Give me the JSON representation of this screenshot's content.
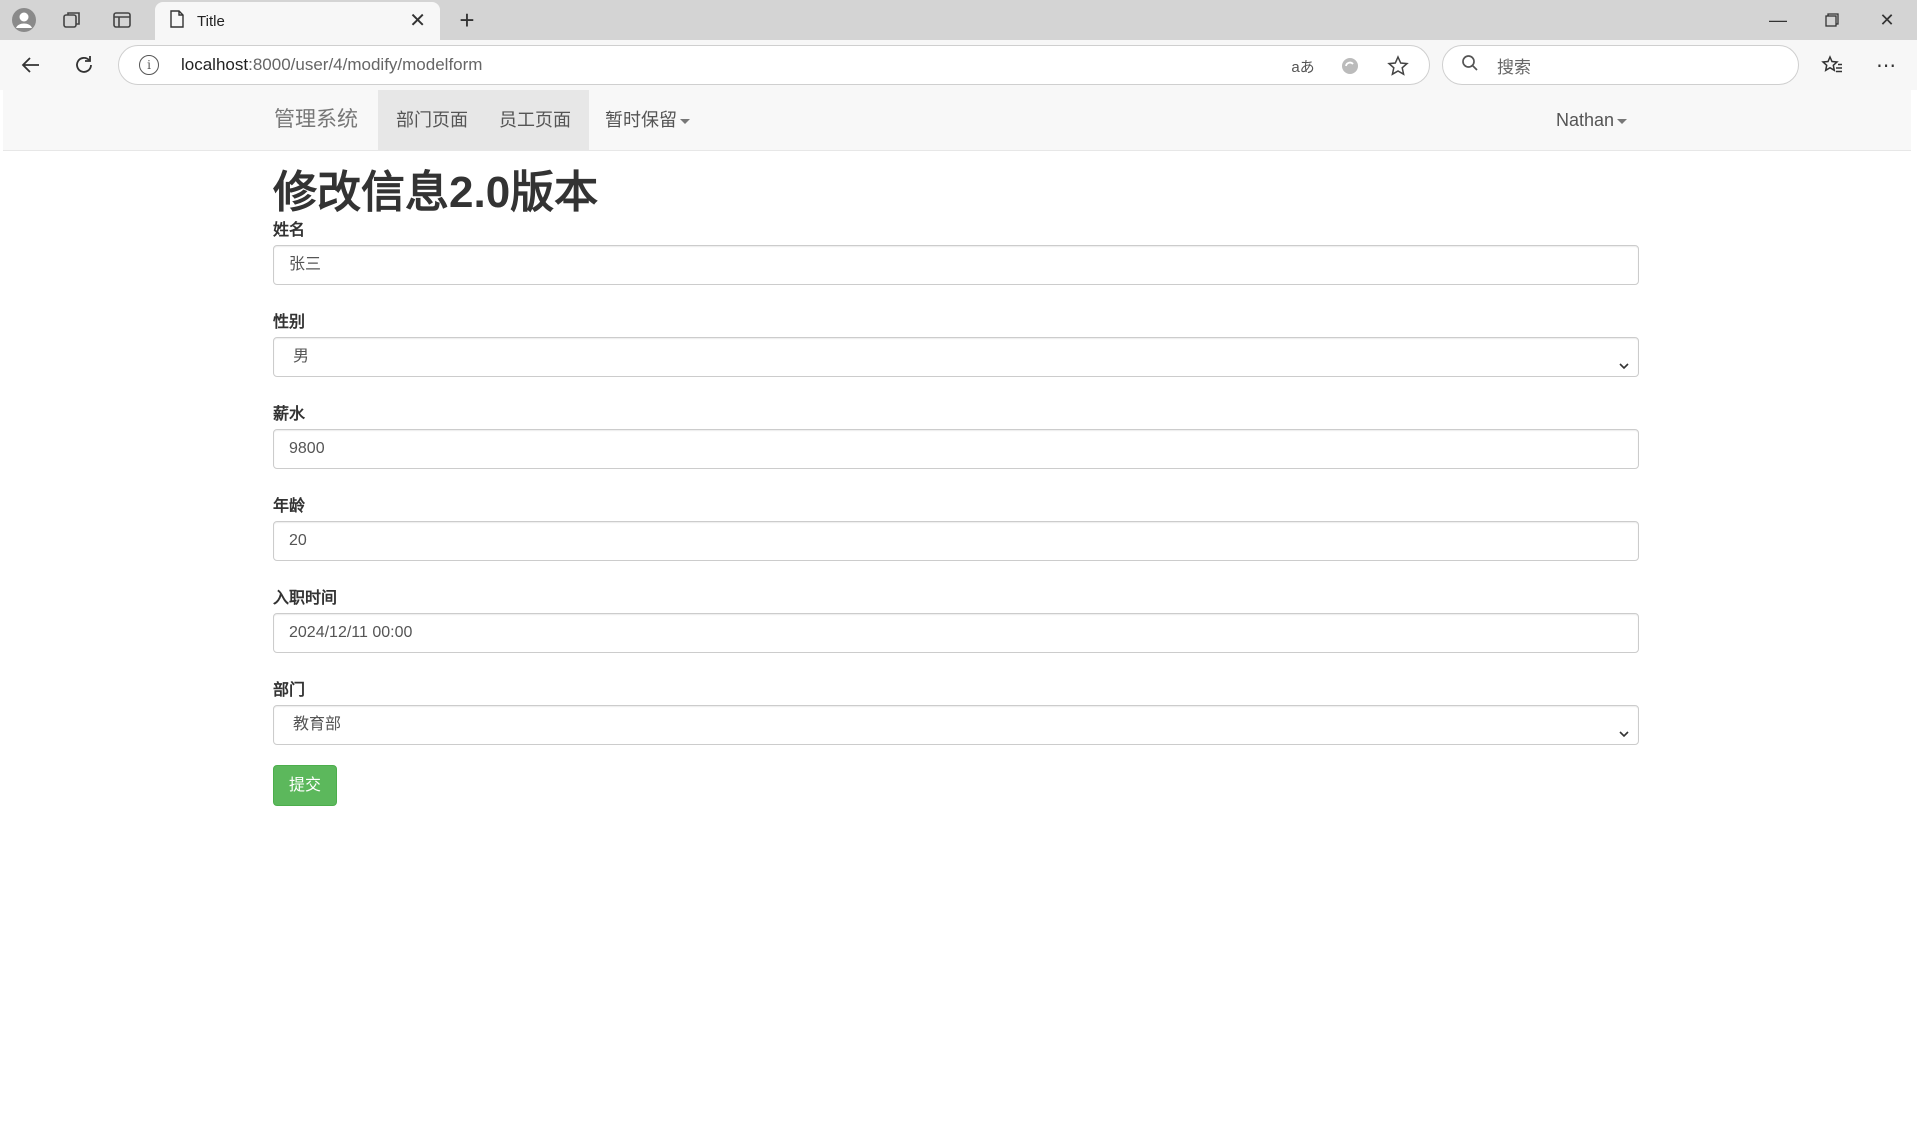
{
  "browser": {
    "tab_title": "Title",
    "url_host": "localhost",
    "url_path": ":8000/user/4/modify/modelform",
    "search_placeholder": "搜索",
    "translate_label": "aあ"
  },
  "navbar": {
    "brand": "管理系统",
    "items": [
      {
        "label": "部门页面"
      },
      {
        "label": "员工页面"
      },
      {
        "label": "暂时保留"
      }
    ],
    "user": "Nathan"
  },
  "page": {
    "heading": "修改信息2.0版本"
  },
  "form": {
    "name": {
      "label": "姓名",
      "value": "张三"
    },
    "gender": {
      "label": "性别",
      "value": "男"
    },
    "salary": {
      "label": "薪水",
      "value": "9800"
    },
    "age": {
      "label": "年龄",
      "value": "20"
    },
    "hire_date": {
      "label": "入职时间",
      "value": "2024/12/11 00:00"
    },
    "department": {
      "label": "部门",
      "value": "教育部"
    },
    "submit_label": "提交"
  },
  "colors": {
    "submit_bg": "#5cb85c",
    "navbar_bg": "#f8f8f8",
    "active_nav_bg": "#e7e7e7"
  }
}
